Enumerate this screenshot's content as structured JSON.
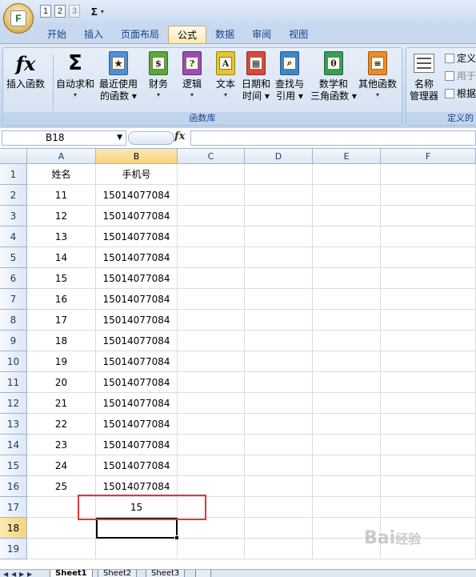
{
  "quick_access": {
    "keys": [
      "1",
      "2",
      "3"
    ],
    "office_key": "F"
  },
  "tabs": [
    "开始",
    "插入",
    "页面布局",
    "公式",
    "数据",
    "审阅",
    "视图"
  ],
  "active_tab": "公式",
  "ribbon": {
    "function_library": {
      "label": "函数库",
      "buttons": [
        {
          "id": "insert_function",
          "line1": "插入函数",
          "line2": "",
          "icon": "fx-icon"
        },
        {
          "id": "autosum",
          "line1": "自动求和",
          "line2": "▾",
          "icon": "sigma-icon"
        },
        {
          "id": "recent",
          "line1": "最近使用",
          "line2": "的函数 ▾",
          "icon": "star-book-icon"
        },
        {
          "id": "financial",
          "line1": "财务",
          "line2": "▾",
          "icon": "finance-book-icon"
        },
        {
          "id": "logical",
          "line1": "逻辑",
          "line2": "▾",
          "icon": "question-book-icon"
        },
        {
          "id": "text",
          "line1": "文本",
          "line2": "▾",
          "icon": "text-book-icon"
        },
        {
          "id": "datetime",
          "line1": "日期和",
          "line2": "时间 ▾",
          "icon": "calendar-book-icon"
        },
        {
          "id": "lookup",
          "line1": "查找与",
          "line2": "引用 ▾",
          "icon": "magnifier-book-icon"
        },
        {
          "id": "math",
          "line1": "数学和",
          "line2": "三角函数 ▾",
          "icon": "theta-book-icon"
        },
        {
          "id": "more",
          "line1": "其他函数",
          "line2": "▾",
          "icon": "orange-book-icon"
        }
      ]
    },
    "defined_names": {
      "label": "定义的",
      "name_manager": {
        "line1": "名称",
        "line2": "管理器"
      },
      "items": [
        "定义",
        "用于",
        "根据"
      ]
    }
  },
  "formula_bar": {
    "name_box": "B18",
    "fx": "fx",
    "formula": ""
  },
  "columns": [
    "A",
    "B",
    "C",
    "D",
    "E",
    "F"
  ],
  "selected_column": "B",
  "selected_row": "18",
  "rows": [
    {
      "n": "1",
      "a": "姓名",
      "b": "手机号"
    },
    {
      "n": "2",
      "a": "11",
      "b": "15014077084"
    },
    {
      "n": "3",
      "a": "12",
      "b": "15014077084"
    },
    {
      "n": "4",
      "a": "13",
      "b": "15014077084"
    },
    {
      "n": "5",
      "a": "14",
      "b": "15014077084"
    },
    {
      "n": "6",
      "a": "15",
      "b": "15014077084"
    },
    {
      "n": "7",
      "a": "16",
      "b": "15014077084"
    },
    {
      "n": "8",
      "a": "17",
      "b": "15014077084"
    },
    {
      "n": "9",
      "a": "18",
      "b": "15014077084"
    },
    {
      "n": "10",
      "a": "19",
      "b": "15014077084"
    },
    {
      "n": "11",
      "a": "20",
      "b": "15014077084"
    },
    {
      "n": "12",
      "a": "21",
      "b": "15014077084"
    },
    {
      "n": "13",
      "a": "22",
      "b": "15014077084"
    },
    {
      "n": "14",
      "a": "23",
      "b": "15014077084"
    },
    {
      "n": "15",
      "a": "24",
      "b": "15014077084"
    },
    {
      "n": "16",
      "a": "25",
      "b": "15014077084"
    },
    {
      "n": "17",
      "a": "",
      "b": "15"
    },
    {
      "n": "18",
      "a": "",
      "b": ""
    },
    {
      "n": "19",
      "a": "",
      "b": ""
    }
  ],
  "sheet_tabs": [
    "Sheet1",
    "Sheet2",
    "Sheet3"
  ],
  "watermark": {
    "text": "Bai",
    "suffix": "经验"
  },
  "colors": {
    "highlight_box": "#d9393c",
    "selection_header": "#f8d37c",
    "ribbon_text": "#15428b"
  }
}
